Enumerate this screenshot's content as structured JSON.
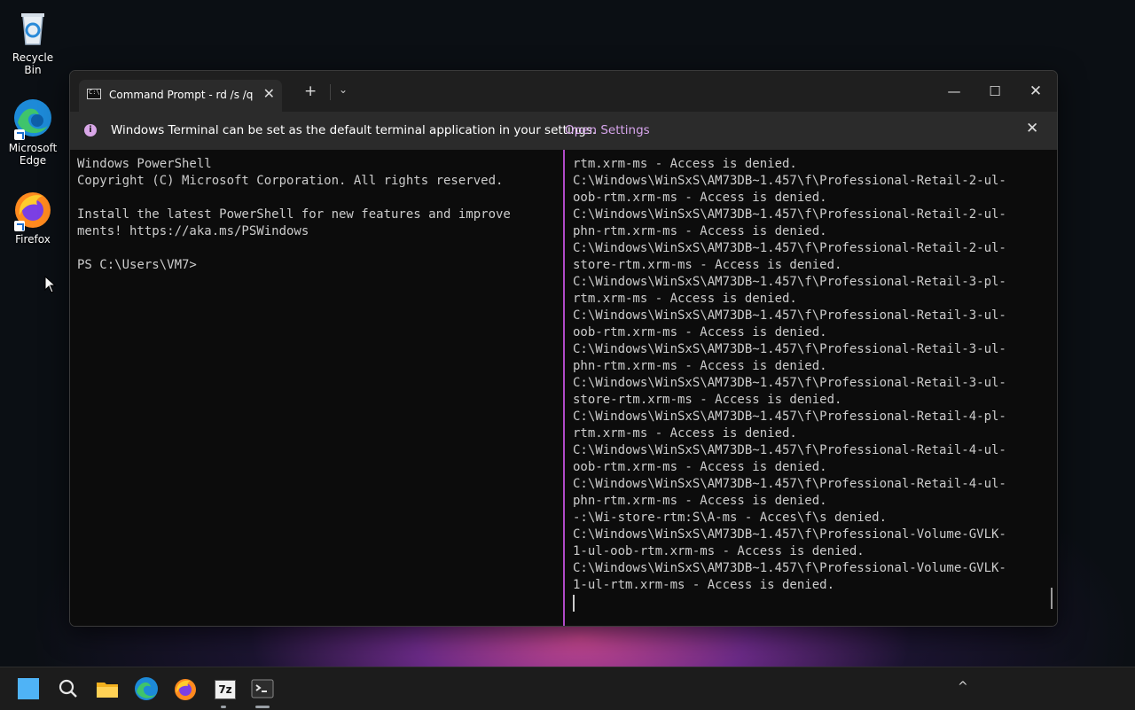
{
  "desktop": {
    "icons": [
      {
        "label": "Recycle Bin"
      },
      {
        "label": "Microsoft Edge"
      },
      {
        "label": "Firefox"
      }
    ]
  },
  "window": {
    "tab_title": "Command Prompt - rd  /s /q C",
    "new_tab_symbol": "+",
    "dropdown_symbol": "⌄",
    "controls": {
      "minimize": "—",
      "maximize": "☐",
      "close": "✕"
    }
  },
  "infobar": {
    "message": "Windows Terminal can be set as the default terminal application in your settings.",
    "link": "Open Settings",
    "close": "✕"
  },
  "left_pane": {
    "text": "Windows PowerShell\nCopyright (C) Microsoft Corporation. All rights reserved.\n\nInstall the latest PowerShell for new features and improve\nments! https://aka.ms/PSWindows\n\nPS C:\\Users\\VM7>"
  },
  "right_pane": {
    "text": "rtm.xrm-ms - Access is denied.\nC:\\Windows\\WinSxS\\AM73DB~1.457\\f\\Professional-Retail-2-ul-\noob-rtm.xrm-ms - Access is denied.\nC:\\Windows\\WinSxS\\AM73DB~1.457\\f\\Professional-Retail-2-ul-\nphn-rtm.xrm-ms - Access is denied.\nC:\\Windows\\WinSxS\\AM73DB~1.457\\f\\Professional-Retail-2-ul-\nstore-rtm.xrm-ms - Access is denied.\nC:\\Windows\\WinSxS\\AM73DB~1.457\\f\\Professional-Retail-3-pl-\nrtm.xrm-ms - Access is denied.\nC:\\Windows\\WinSxS\\AM73DB~1.457\\f\\Professional-Retail-3-ul-\noob-rtm.xrm-ms - Access is denied.\nC:\\Windows\\WinSxS\\AM73DB~1.457\\f\\Professional-Retail-3-ul-\nphn-rtm.xrm-ms - Access is denied.\nC:\\Windows\\WinSxS\\AM73DB~1.457\\f\\Professional-Retail-3-ul-\nstore-rtm.xrm-ms - Access is denied.\nC:\\Windows\\WinSxS\\AM73DB~1.457\\f\\Professional-Retail-4-pl-\nrtm.xrm-ms - Access is denied.\nC:\\Windows\\WinSxS\\AM73DB~1.457\\f\\Professional-Retail-4-ul-\noob-rtm.xrm-ms - Access is denied.\nC:\\Windows\\WinSxS\\AM73DB~1.457\\f\\Professional-Retail-4-ul-\nphn-rtm.xrm-ms - Access is denied.\n-:\\Wi-store-rtm:S\\A-ms - Acces\\f\\s denied.\nC:\\Windows\\WinSxS\\AM73DB~1.457\\f\\Professional-Volume-GVLK-\n1-ul-oob-rtm.xrm-ms - Access is denied.\nC:\\Windows\\WinSxS\\AM73DB~1.457\\f\\Professional-Volume-GVLK-\n1-ul-rtm.xrm-ms - Access is denied."
  },
  "taskbar": {
    "items": [
      "start-icon",
      "search-icon",
      "file-explorer-icon",
      "edge-icon",
      "firefox-icon",
      "7zip-icon",
      "terminal-icon"
    ],
    "seven_zip_label": "7z",
    "tray_chevron": "^"
  },
  "colors": {
    "accent_divider": "#b04ac7",
    "link": "#d7a5ec",
    "terminal_bg": "#0c0c0c",
    "terminal_fg": "#cccccc"
  }
}
